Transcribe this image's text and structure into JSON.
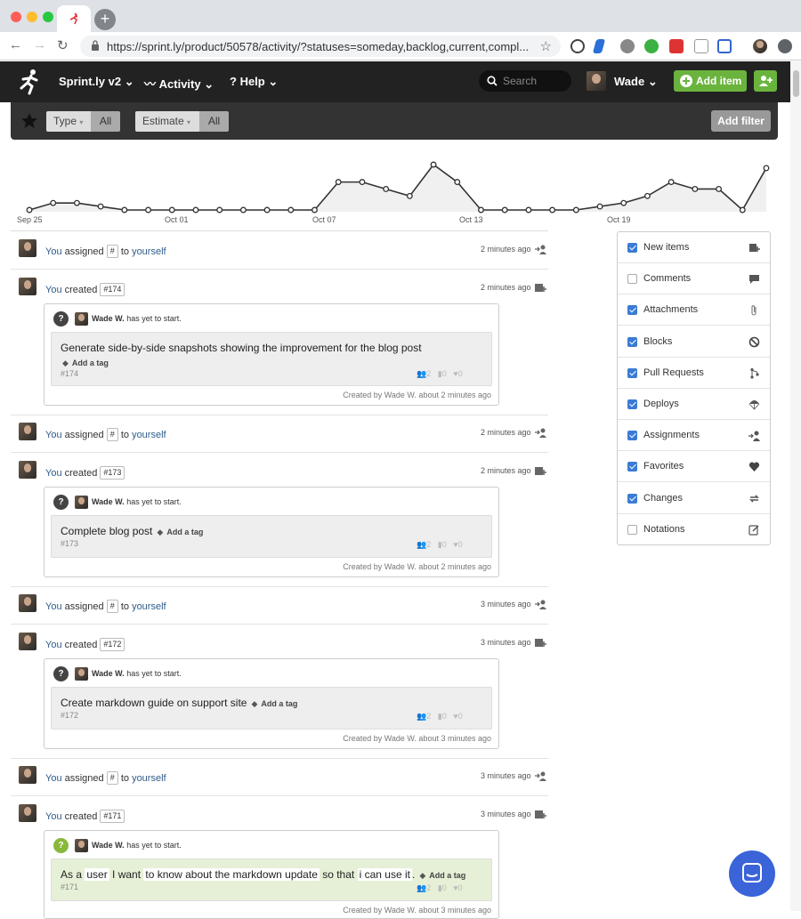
{
  "browser": {
    "url": "https://sprint.ly/product/50578/activity/?statuses=someday,backlog,current,compl...",
    "new_tab_label": "+"
  },
  "nav": {
    "product": "Sprint.ly v2",
    "activity": "Activity",
    "help": "Help",
    "search_placeholder": "Search",
    "user": "Wade",
    "add_item": "Add item"
  },
  "filters": {
    "type_label": "Type",
    "type_value": "All",
    "estimate_label": "Estimate",
    "estimate_value": "All",
    "add_filter": "Add filter"
  },
  "chart_data": {
    "type": "line",
    "x_ticks": [
      "Sep 25",
      "Oct 01",
      "Oct 07",
      "Oct 13",
      "Oct 19"
    ],
    "values": [
      1,
      3,
      3,
      2,
      1,
      1,
      1,
      1,
      1,
      1,
      1,
      1,
      1,
      9,
      9,
      7,
      5,
      14,
      9,
      1,
      1,
      1,
      1,
      1,
      2,
      3,
      5,
      9,
      7,
      7,
      1,
      13
    ],
    "grid": false,
    "area_fill": "#f0f0f0",
    "line_color": "#333333"
  },
  "feed": [
    {
      "kind": "assign",
      "actor": "You",
      "verb": "assigned",
      "item": "#",
      "to": "to",
      "target": "yourself",
      "time": "2 minutes ago"
    },
    {
      "kind": "create",
      "actor": "You",
      "verb": "created",
      "item": "#174",
      "time": "2 minutes ago",
      "card": {
        "status_icon": "?",
        "owner": "Wade W.",
        "status": "has yet to start.",
        "title": "Generate side-by-side snapshots showing the improvement for the blog post",
        "tag": "Add a tag",
        "number": "#174",
        "assignees": "2",
        "comments": "0",
        "favorites": "0",
        "created": "Created by Wade W. about 2 minutes ago"
      }
    },
    {
      "kind": "assign",
      "actor": "You",
      "verb": "assigned",
      "item": "#",
      "to": "to",
      "target": "yourself",
      "time": "2 minutes ago"
    },
    {
      "kind": "create",
      "actor": "You",
      "verb": "created",
      "item": "#173",
      "time": "2 minutes ago",
      "card": {
        "status_icon": "?",
        "owner": "Wade W.",
        "status": "has yet to start.",
        "title": "Complete blog post",
        "tag": "Add a tag",
        "number": "#173",
        "assignees": "2",
        "comments": "0",
        "favorites": "0",
        "created": "Created by Wade W. about 2 minutes ago"
      }
    },
    {
      "kind": "assign",
      "actor": "You",
      "verb": "assigned",
      "item": "#",
      "to": "to",
      "target": "yourself",
      "time": "3 minutes ago"
    },
    {
      "kind": "create",
      "actor": "You",
      "verb": "created",
      "item": "#172",
      "time": "3 minutes ago",
      "card": {
        "status_icon": "?",
        "owner": "Wade W.",
        "status": "has yet to start.",
        "title": "Create markdown guide on support site",
        "tag": "Add a tag",
        "number": "#172",
        "assignees": "2",
        "comments": "0",
        "favorites": "0",
        "created": "Created by Wade W. about 3 minutes ago"
      }
    },
    {
      "kind": "assign",
      "actor": "You",
      "verb": "assigned",
      "item": "#",
      "to": "to",
      "target": "yourself",
      "time": "3 minutes ago"
    },
    {
      "kind": "create",
      "actor": "You",
      "verb": "created",
      "item": "#171",
      "time": "3 minutes ago",
      "card": {
        "status_icon": "?",
        "owner": "Wade W.",
        "status": "has yet to start.",
        "story": {
          "as_a": "As a",
          "who": "user",
          "i_want": "I want",
          "what": "to know about the markdown update",
          "so_that": "so that",
          "why": "i can use it",
          "end": "."
        },
        "tag": "Add a tag",
        "number": "#171",
        "assignees": "2",
        "comments": "0",
        "favorites": "0",
        "created": "Created by Wade W. about 3 minutes ago"
      }
    }
  ],
  "sidebar": {
    "items": [
      {
        "label": "New items",
        "checked": true,
        "icon": "new-item-icon"
      },
      {
        "label": "Comments",
        "checked": false,
        "icon": "comment-icon"
      },
      {
        "label": "Attachments",
        "checked": true,
        "icon": "paperclip-icon"
      },
      {
        "label": "Blocks",
        "checked": true,
        "icon": "block-icon"
      },
      {
        "label": "Pull Requests",
        "checked": true,
        "icon": "pull-request-icon"
      },
      {
        "label": "Deploys",
        "checked": true,
        "icon": "parachute-icon"
      },
      {
        "label": "Assignments",
        "checked": true,
        "icon": "assign-user-icon"
      },
      {
        "label": "Favorites",
        "checked": true,
        "icon": "heart-icon"
      },
      {
        "label": "Changes",
        "checked": true,
        "icon": "change-icon"
      },
      {
        "label": "Notations",
        "checked": false,
        "icon": "notation-icon"
      }
    ]
  },
  "colors": {
    "accent_green": "#6ab43e",
    "nav_bg": "#222222",
    "link": "#2f5c8a",
    "checkbox": "#3a7bd5",
    "story_green": "#8ab83a"
  }
}
